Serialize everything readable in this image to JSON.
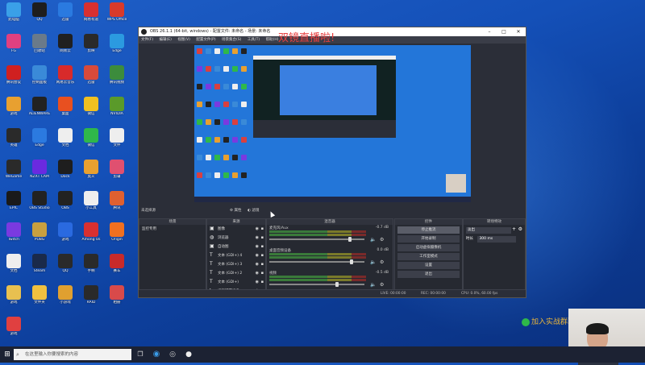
{
  "desktop_icons": [
    {
      "label": "此电脑",
      "color": "#3aa0e8"
    },
    {
      "label": "QQ",
      "color": "#1e1e1e"
    },
    {
      "label": "迅雷",
      "color": "#2a7ae0"
    },
    {
      "label": "网易有道",
      "color": "#d83030"
    },
    {
      "label": "WPS Office",
      "color": "#d83a2a"
    },
    {
      "label": "FG",
      "color": "#e04080"
    },
    {
      "label": "回收站",
      "color": "#6a7a8a"
    },
    {
      "label": "网易云",
      "color": "#202020"
    },
    {
      "label": "剪映",
      "color": "#2a2a2a"
    },
    {
      "label": "Edge",
      "color": "#2b9ae0"
    },
    {
      "label": "腾讯会议",
      "color": "#d02020"
    },
    {
      "label": "控制面板",
      "color": "#3a8ad8"
    },
    {
      "label": "网易云音乐",
      "color": "#d82a2a"
    },
    {
      "label": "迅雷",
      "color": "#d84a3a"
    },
    {
      "label": "腾讯视频",
      "color": "#3c8c3c"
    },
    {
      "label": "游戏",
      "color": "#e8a030"
    },
    {
      "label": "ALIENWARE",
      "color": "#222"
    },
    {
      "label": "桌面",
      "color": "#e85020"
    },
    {
      "label": "微信",
      "color": "#f0c020"
    },
    {
      "label": "NVIDIA",
      "color": "#5a9a2a"
    },
    {
      "label": "英雄",
      "color": "#2a2a2a"
    },
    {
      "label": "Edge",
      "color": "#2b7ae0"
    },
    {
      "label": "文档",
      "color": "#eeeeee"
    },
    {
      "label": "微信",
      "color": "#2fb84a"
    },
    {
      "label": "文件",
      "color": "#eeeeee"
    },
    {
      "label": "WeGame",
      "color": "#2a2a2a"
    },
    {
      "label": "NZXT CAM",
      "color": "#6a2ae0"
    },
    {
      "label": "Dock",
      "color": "#1e1e1e"
    },
    {
      "label": "奥义",
      "color": "#e8a030"
    },
    {
      "label": "剪辑",
      "color": "#e05070"
    },
    {
      "label": "EPIC",
      "color": "#1a1a1a"
    },
    {
      "label": "OBS Studio",
      "color": "#222"
    },
    {
      "label": "OBS",
      "color": "#222"
    },
    {
      "label": "小工具",
      "color": "#eee"
    },
    {
      "label": "腾讯",
      "color": "#e06030"
    },
    {
      "label": "Twitch",
      "color": "#7a3ae0"
    },
    {
      "label": "PUBG",
      "color": "#c8a040"
    },
    {
      "label": "游戏",
      "color": "#2a6ae0"
    },
    {
      "label": "Among Us",
      "color": "#d83030"
    },
    {
      "label": "Origin",
      "color": "#f07020"
    },
    {
      "label": "文档",
      "color": "#eeeeee"
    },
    {
      "label": "Steam",
      "color": "#1a2a4a"
    },
    {
      "label": "QQ",
      "color": "#2a2a2a"
    },
    {
      "label": "手柄",
      "color": "#2a2a2a"
    },
    {
      "label": "赛车",
      "color": "#c82a2a"
    },
    {
      "label": "游戏",
      "color": "#e8c050"
    },
    {
      "label": "文件夹",
      "color": "#f0c040"
    },
    {
      "label": "小游戏",
      "color": "#e0a030"
    },
    {
      "label": "RAID",
      "color": "#2a2a2a"
    },
    {
      "label": "相册",
      "color": "#d84a4a"
    },
    {
      "label": "游戏",
      "color": "#e04040"
    }
  ],
  "obs": {
    "title": "OBS 26.1.1 (64-bit, windows) - 配置文件: 未命名 - 场景: 未命名",
    "menu": [
      "文件(F)",
      "编辑(E)",
      "视图(V)",
      "配置文件(P)",
      "场景集合(S)",
      "工具(T)",
      "帮助(H)"
    ],
    "overlay_text": "双镜直播啦!",
    "dockbar": {
      "left": "未选择源",
      "props": "属性",
      "filters": "滤镜"
    },
    "scenes": {
      "header": "场景",
      "items": [
        "监控专用"
      ]
    },
    "sources": {
      "header": "来源",
      "items": [
        {
          "label": "图像",
          "icon": "▣"
        },
        {
          "label": "浏览器",
          "icon": "◍"
        },
        {
          "label": "自动图",
          "icon": "▣"
        },
        {
          "label": "文本 (GDI+) 4",
          "icon": "T"
        },
        {
          "label": "文本 (GDI+) 3",
          "icon": "T"
        },
        {
          "label": "文本 (GDI+) 2",
          "icon": "T"
        },
        {
          "label": "文本 (GDI+)",
          "icon": "T"
        },
        {
          "label": "视频捕获设备",
          "icon": "▶"
        }
      ]
    },
    "mixer": {
      "header": "混音器",
      "channels": [
        {
          "name": "麦克风/Aux",
          "db": "-0.7 dB",
          "level": 0.86
        },
        {
          "name": "桌面音频设备",
          "db": "0.0 dB",
          "level": 0.88
        },
        {
          "name": "视频",
          "db": "-0.5 dB",
          "level": 0.72
        }
      ]
    },
    "controls": {
      "header": "控件",
      "buttons": [
        "停止推流",
        "开始录制",
        "启动虚拟摄像机",
        "工作室模式",
        "设置",
        "退出"
      ]
    },
    "transitions": {
      "header": "转场特效",
      "type": "淡出",
      "duration_label": "时长",
      "duration": "300 ms"
    },
    "status": {
      "live": "LIVE: 00:00:00",
      "rec": "REC: 00:00:00",
      "cpu": "CPU: 0.0%, 60.00 fps"
    }
  },
  "watermark": "加入实战群联系进vx群",
  "taskbar": {
    "search_placeholder": "在这里输入你要搜索的内容"
  }
}
